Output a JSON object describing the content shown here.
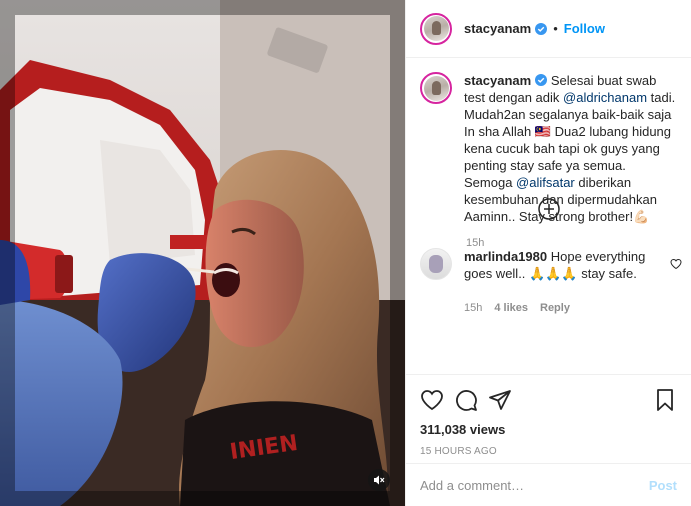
{
  "media": {
    "mute_icon": "speaker-muted-icon"
  },
  "header": {
    "username": "stacyanam",
    "separator": "•",
    "follow_label": "Follow"
  },
  "caption": {
    "username": "stacyanam",
    "text_1": "Selesai buat swab test dengan adik ",
    "mention_1": "@aldrichanam",
    "text_2": " tadi. Mudah2an segalanya baik-baik saja In sha Allah 🇲🇾 Dua2 lubang hidung kena cucuk bah tapi ok guys yang penting stay safe ya semua. Semoga ",
    "mention_2": "@alifsatar",
    "text_3": " diberikan kesembuhan dan dipermudahkan Aaminn.. Stay strong brother!💪🏻",
    "time": "15h"
  },
  "load_more_icon": "plus-circle-icon",
  "comment": {
    "username": "marlinda1980",
    "text": " Hope everything goes well.. 🙏🙏🙏 stay safe.",
    "time": "15h",
    "likes": "4 likes",
    "reply": "Reply"
  },
  "stats": {
    "views": "311,038 views",
    "posted": "15 HOURS AGO"
  },
  "add_comment": {
    "placeholder": "Add a comment…",
    "post_label": "Post"
  },
  "colors": {
    "accent": "#0095f6",
    "mention": "#00376b",
    "muted": "#8e8e8e",
    "post_disabled": "#b2dffc"
  }
}
